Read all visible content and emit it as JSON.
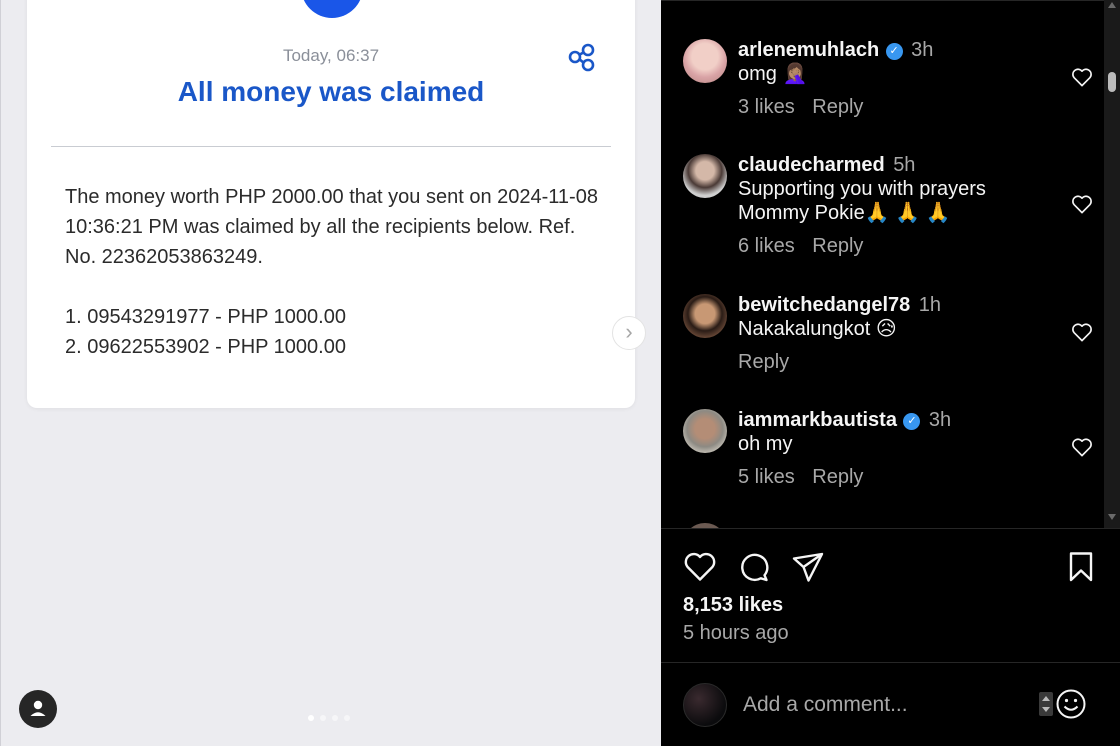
{
  "card": {
    "timestamp": "Today, 06:37",
    "title": "All money was claimed",
    "message": "The money worth PHP 2000.00 that you sent on 2024-11-08 10:36:21 PM was claimed by all the recipients below. Ref. No. 22362053863249.",
    "recipients": [
      "1. 09543291977 - PHP 1000.00",
      "2. 09622553902 - PHP 1000.00"
    ]
  },
  "carousel": {
    "next_icon": "chevron-right-icon",
    "dots": 4,
    "active_dot": 0
  },
  "comments": [
    {
      "username": "arlenemuhlach",
      "verified": true,
      "time": "3h",
      "text": "omg 🤦🏽‍♀️",
      "likes": "3 likes",
      "reply": "Reply"
    },
    {
      "username": "claudecharmed",
      "verified": false,
      "time": "5h",
      "text": "Supporting you with prayers Mommy Pokie🙏 🙏 🙏",
      "likes": "6 likes",
      "reply": "Reply"
    },
    {
      "username": "bewitchedangel78",
      "verified": false,
      "time": "1h",
      "text": "Nakakalungkot 😥",
      "likes": "",
      "reply": "Reply"
    },
    {
      "username": "iammarkbautista",
      "verified": true,
      "time": "3h",
      "text": "oh my",
      "likes": "5 likes",
      "reply": "Reply"
    }
  ],
  "post": {
    "likes": "8,153 likes",
    "posted": "5 hours ago",
    "comment_placeholder": "Add a comment..."
  },
  "colors": {
    "accent_blue": "#1a57c8",
    "verified_blue": "#3897f0",
    "panel_bg": "#000000",
    "muted_text": "#a8a8a8"
  }
}
